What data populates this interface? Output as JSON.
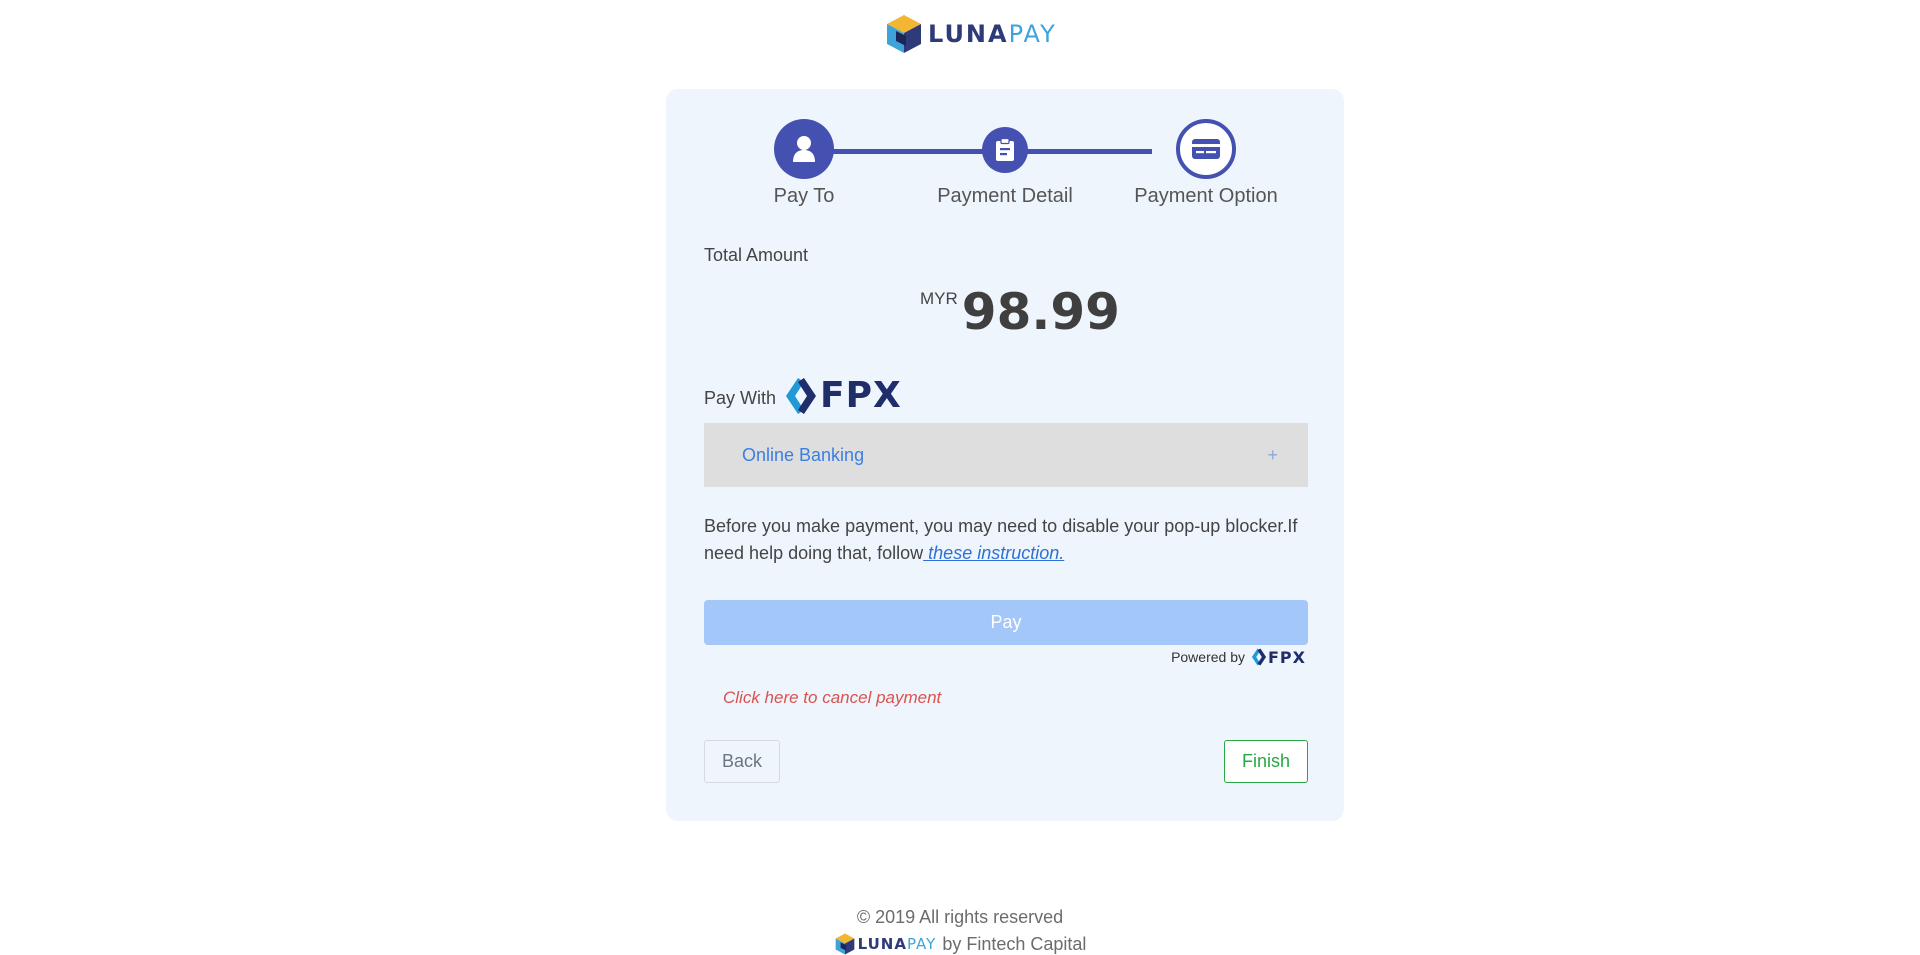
{
  "brand": {
    "name_part1": "LUNA",
    "name_part2": "PAY",
    "primary_color": "#2f3a78",
    "accent_color": "#3fa3da",
    "icon": "lunapay-cube-logo"
  },
  "stepper": {
    "steps": [
      {
        "label": "Pay To",
        "icon": "user-icon",
        "state": "complete"
      },
      {
        "label": "Payment Detail",
        "icon": "clipboard-icon",
        "state": "complete"
      },
      {
        "label": "Payment Option",
        "icon": "credit-card-icon",
        "state": "active"
      }
    ],
    "color": "#4451b1"
  },
  "payment": {
    "total_label": "Total Amount",
    "currency": "MYR",
    "amount": "98.99"
  },
  "pay_with": {
    "label": "Pay With",
    "provider": "FPX"
  },
  "accordion": {
    "label": "Online Banking",
    "toggle_icon": "+"
  },
  "notice": {
    "text": "Before you make payment, you may need to disable your pop-up blocker.If need help doing that, follow",
    "link_text": " these instruction."
  },
  "pay_button": {
    "label": "Pay"
  },
  "powered_by": {
    "label": "Powered by",
    "provider": "FPX"
  },
  "cancel": {
    "label": "Click here to cancel payment",
    "color": "#d9534f"
  },
  "nav": {
    "back_label": "Back",
    "finish_label": "Finish",
    "finish_color": "#28a745"
  },
  "footer": {
    "copyright": "© 2019 All rights reserved",
    "byline": "by Fintech Capital"
  }
}
